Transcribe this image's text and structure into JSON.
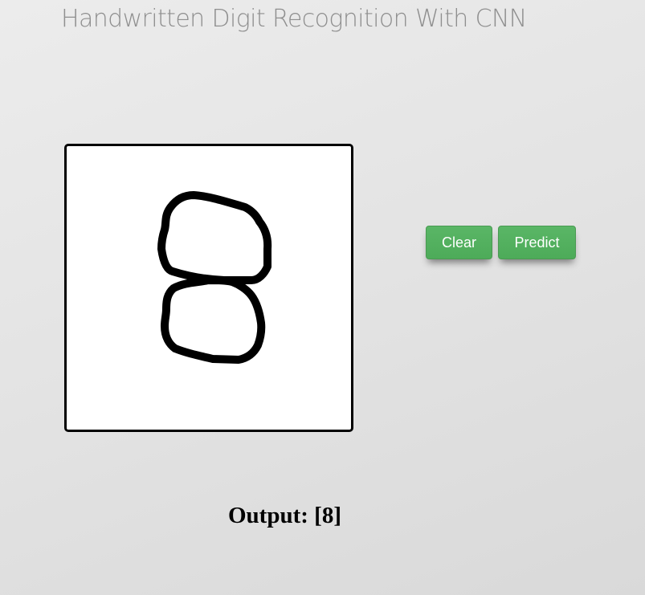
{
  "header": {
    "title": "Handwritten Digit Recognition With CNN"
  },
  "canvas": {
    "background": "#ffffff",
    "border_color": "#000000",
    "stroke_color": "#000000",
    "drawn_digit": "8"
  },
  "controls": {
    "clear_label": "Clear",
    "predict_label": "Predict",
    "button_color": "#4dab59"
  },
  "result": {
    "label": "Output:",
    "value": "[8]"
  }
}
